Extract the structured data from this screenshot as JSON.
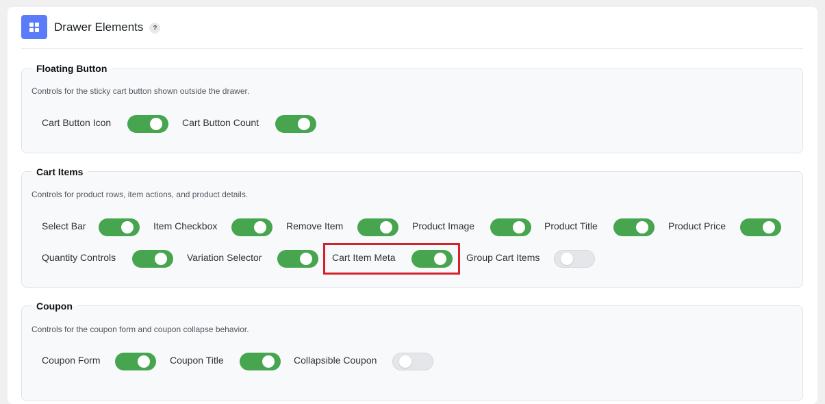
{
  "header": {
    "title": "Drawer Elements",
    "help": "?",
    "icon": "grid-icon",
    "icon_color": "#5b7cfa"
  },
  "sections": {
    "floating": {
      "title": "Floating Button",
      "description": "Controls for the sticky cart button shown outside the drawer.",
      "toggles": [
        {
          "label": "Cart Button Icon",
          "on": true
        },
        {
          "label": "Cart Button Count",
          "on": true
        }
      ]
    },
    "cart_items": {
      "title": "Cart Items",
      "description": "Controls for product rows, item actions, and product details.",
      "toggles": [
        {
          "label": "Select Bar",
          "on": true
        },
        {
          "label": "Item Checkbox",
          "on": true
        },
        {
          "label": "Remove Item",
          "on": true
        },
        {
          "label": "Product Image",
          "on": true
        },
        {
          "label": "Product Title",
          "on": true
        },
        {
          "label": "Product Price",
          "on": true
        },
        {
          "label": "Quantity Controls",
          "on": true
        },
        {
          "label": "Variation Selector",
          "on": true
        },
        {
          "label": "Cart Item Meta",
          "on": true,
          "highlighted": true
        },
        {
          "label": "Group Cart Items",
          "on": false
        }
      ]
    },
    "coupon": {
      "title": "Coupon",
      "description": "Controls for the coupon form and coupon collapse behavior.",
      "toggles": [
        {
          "label": "Coupon Form",
          "on": true
        },
        {
          "label": "Coupon Title",
          "on": true
        },
        {
          "label": "Collapsible Coupon",
          "on": false
        }
      ]
    }
  },
  "colors": {
    "toggle_on": "#46a54e",
    "toggle_off": "#e4e6e9",
    "highlight": "#d4212b"
  }
}
